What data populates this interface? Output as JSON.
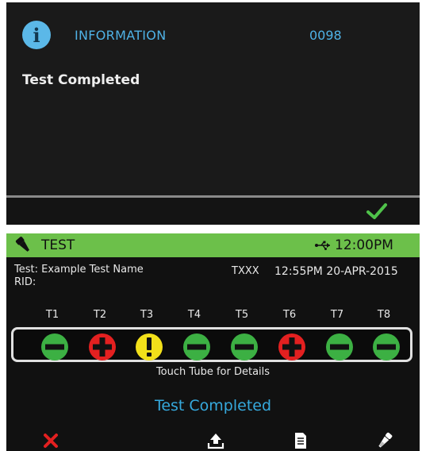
{
  "dialog": {
    "title": "INFORMATION",
    "code": "0098",
    "message": "Test Completed",
    "icons": {
      "info": "info-icon",
      "confirm": "checkmark-icon"
    },
    "colors": {
      "title": "#4fb2e6",
      "confirm": "#4fc24a"
    }
  },
  "test_screen": {
    "header": {
      "title": "TEST",
      "time": "12:00PM",
      "icons": {
        "left": "pipette-icon",
        "connection": "usb-icon"
      },
      "color": "#6cc04a"
    },
    "info": {
      "test_label": "Test: Example Test Name",
      "rid_label": "RID:",
      "code": "TXXX",
      "datetime": "12:55PM 20-APR-2015"
    },
    "tubes": [
      {
        "label": "T1",
        "result": "negative",
        "color": "#3cb043"
      },
      {
        "label": "T2",
        "result": "positive",
        "color": "#e32020"
      },
      {
        "label": "T3",
        "result": "warning",
        "color": "#f2e01a"
      },
      {
        "label": "T4",
        "result": "negative",
        "color": "#3cb043"
      },
      {
        "label": "T5",
        "result": "negative",
        "color": "#3cb043"
      },
      {
        "label": "T6",
        "result": "positive",
        "color": "#e32020"
      },
      {
        "label": "T7",
        "result": "negative",
        "color": "#3cb043"
      },
      {
        "label": "T8",
        "result": "negative",
        "color": "#3cb043"
      }
    ],
    "hint": "Touch Tube for Details",
    "status": "Test Completed",
    "buttons": [
      "cancel-icon",
      "upload-icon",
      "document-icon",
      "pipette-icon"
    ]
  }
}
